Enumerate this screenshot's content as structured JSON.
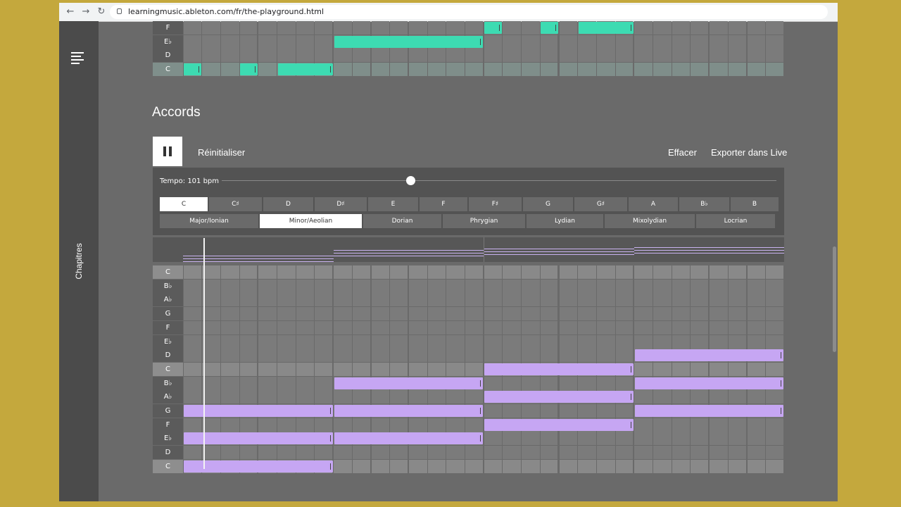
{
  "browser": {
    "url": "learningmusic.ableton.com/fr/the-playground.html",
    "back_icon": "←",
    "forward_icon": "→",
    "reload_icon": "↻"
  },
  "sidebar": {
    "chapters_label": "Chapitres",
    "menu_icon": "hamburger-menu"
  },
  "melody": {
    "rows": [
      "F",
      "E♭",
      "D",
      "C"
    ],
    "notes": [
      {
        "row": 0,
        "start": 16,
        "length": 1
      },
      {
        "row": 0,
        "start": 19,
        "length": 1
      },
      {
        "row": 0,
        "start": 21,
        "length": 3
      },
      {
        "row": 1,
        "start": 8,
        "length": 8
      },
      {
        "row": 3,
        "start": 0,
        "length": 1
      },
      {
        "row": 3,
        "start": 3,
        "length": 1
      },
      {
        "row": 3,
        "start": 5,
        "length": 3
      }
    ],
    "note_color": "#3ddbb2"
  },
  "chords": {
    "title": "Accords",
    "play_state": "playing",
    "reset_label": "Réinitialiser",
    "clear_label": "Effacer",
    "export_label": "Exporter dans Live",
    "tempo_label": "Tempo: 101 bpm",
    "tempo_fraction": 0.34,
    "keys": [
      "C",
      "C♯",
      "D",
      "D♯",
      "E",
      "F",
      "F♯",
      "G",
      "G♯",
      "A",
      "B♭",
      "B"
    ],
    "selected_key": "C",
    "scales": [
      "Major/Ionian",
      "Minor/Aeolian",
      "Dorian",
      "Phrygian",
      "Lydian",
      "Mixolydian",
      "Locrian"
    ],
    "selected_scale": "Minor/Aeolian",
    "rows": [
      "C",
      "B♭",
      "A♭",
      "G",
      "F",
      "E♭",
      "D",
      "C",
      "B♭",
      "A♭",
      "G",
      "F",
      "E♭",
      "D",
      "C"
    ],
    "root_rows": [
      0,
      7,
      14
    ],
    "steps": 32,
    "playhead_step": 1.1,
    "notes": [
      {
        "row": 10,
        "start": 0,
        "length": 8
      },
      {
        "row": 12,
        "start": 0,
        "length": 8
      },
      {
        "row": 14,
        "start": 0,
        "length": 8
      },
      {
        "row": 8,
        "start": 8,
        "length": 8
      },
      {
        "row": 10,
        "start": 8,
        "length": 8
      },
      {
        "row": 12,
        "start": 8,
        "length": 8
      },
      {
        "row": 7,
        "start": 16,
        "length": 8
      },
      {
        "row": 9,
        "start": 16,
        "length": 8
      },
      {
        "row": 11,
        "start": 16,
        "length": 8
      },
      {
        "row": 6,
        "start": 24,
        "length": 8
      },
      {
        "row": 8,
        "start": 24,
        "length": 8
      },
      {
        "row": 10,
        "start": 24,
        "length": 8
      }
    ],
    "note_color": "#c6a6f3"
  }
}
